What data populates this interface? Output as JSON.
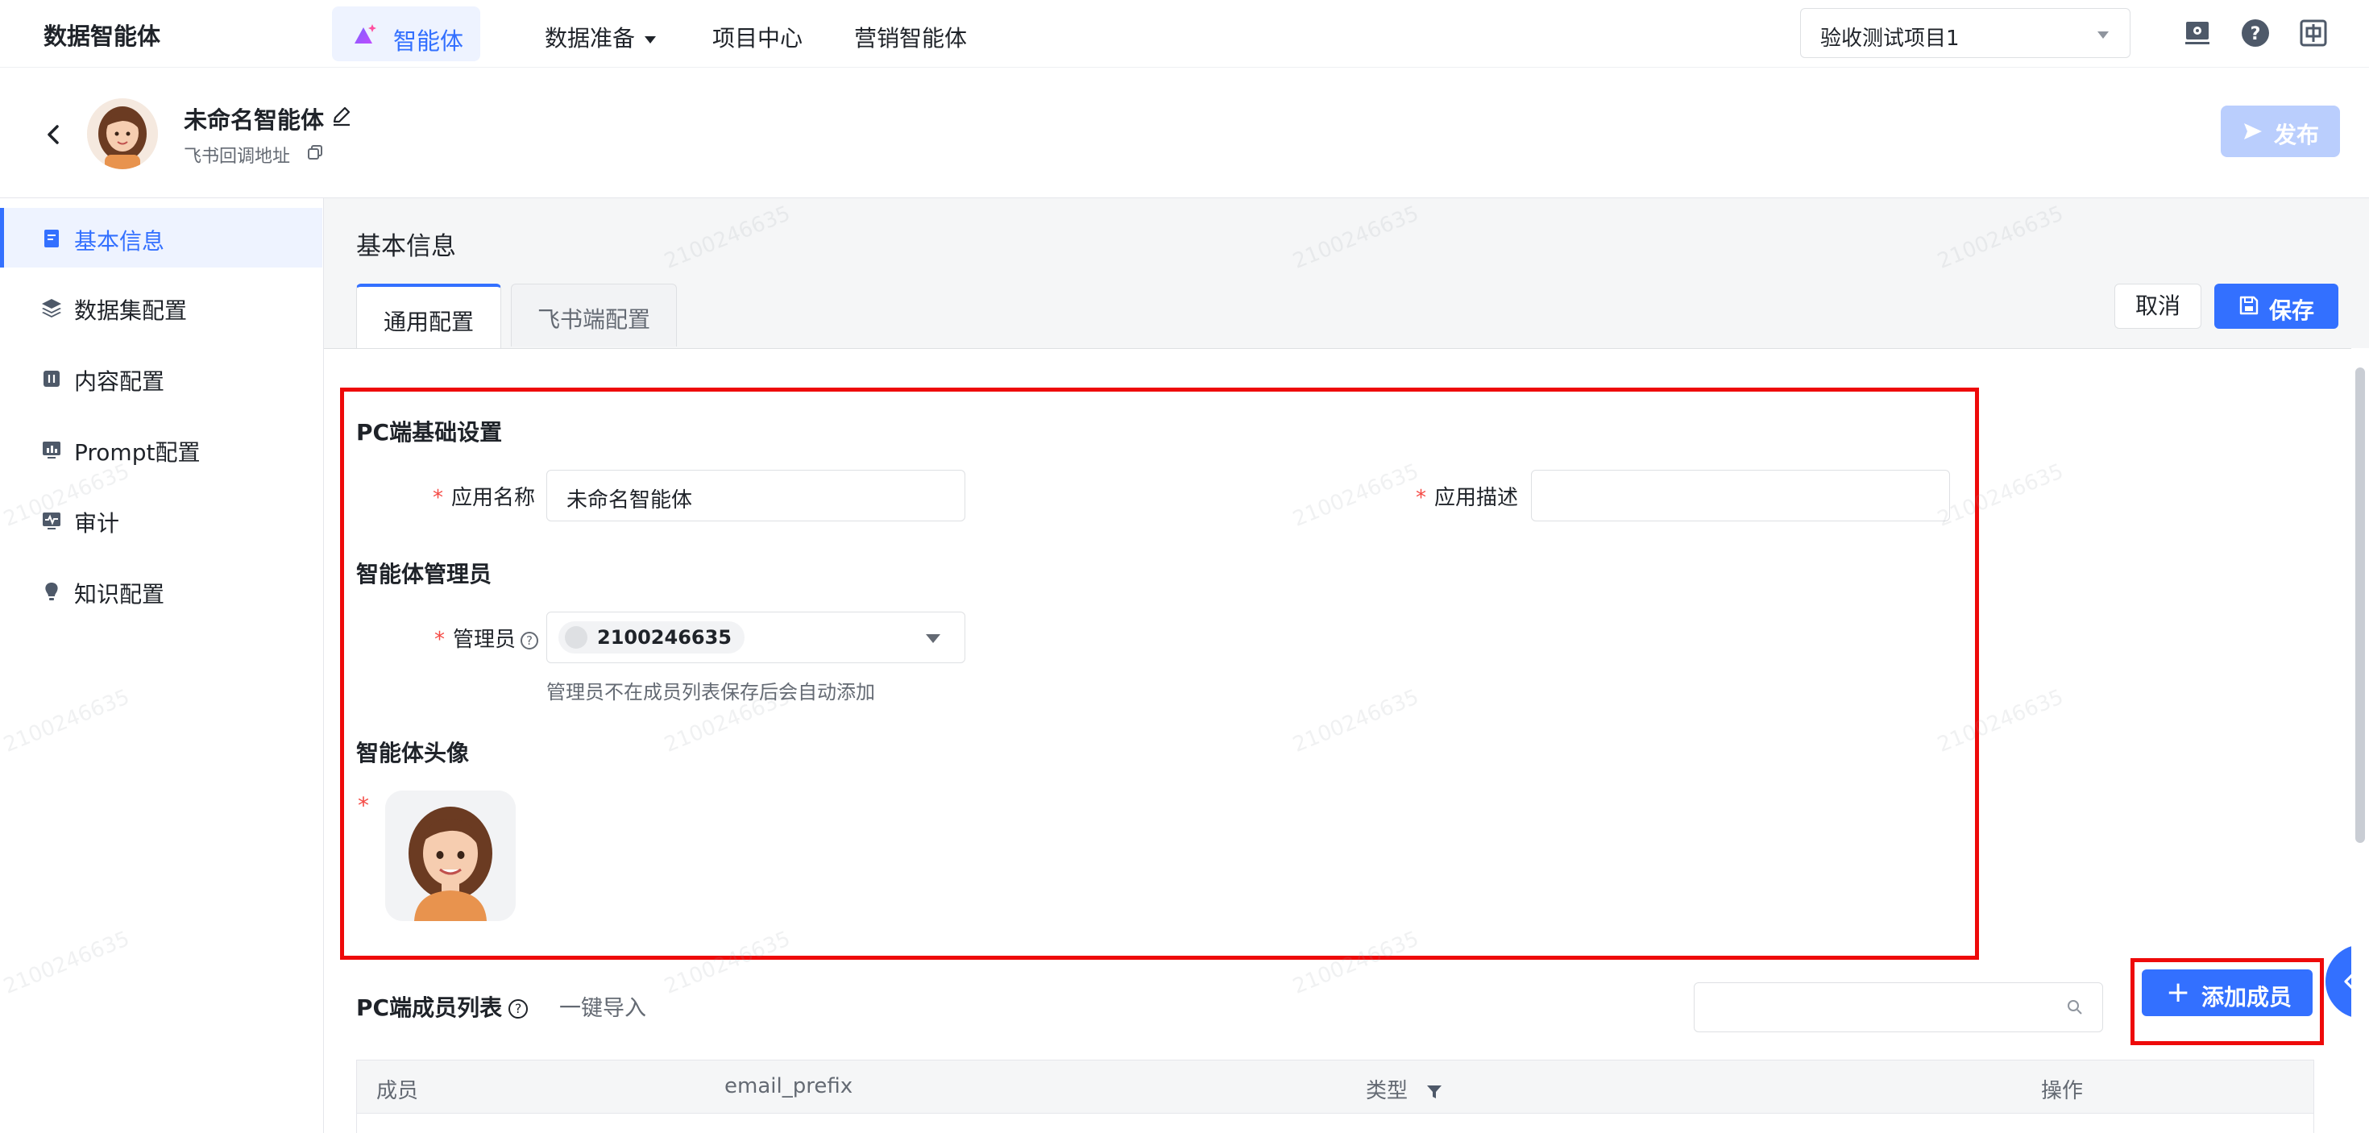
{
  "topbar": {
    "brand": "数据智能体",
    "nav": {
      "active": "智能体",
      "items": [
        "数据准备",
        "项目中心",
        "营销智能体"
      ]
    },
    "project_select": "验收测试项目1",
    "icons": [
      "monitor-settings-icon",
      "help-icon",
      "language-switch-icon"
    ]
  },
  "header": {
    "agent_name": "未命名智能体",
    "callback_label": "飞书回调地址",
    "publish_label": "发布"
  },
  "sidebar": {
    "items": [
      {
        "label": "基本信息",
        "icon": "document-icon",
        "active": true
      },
      {
        "label": "数据集配置",
        "icon": "layers-icon"
      },
      {
        "label": "内容配置",
        "icon": "content-icon"
      },
      {
        "label": "Prompt配置",
        "icon": "chart-icon"
      },
      {
        "label": "审计",
        "icon": "audit-icon"
      },
      {
        "label": "知识配置",
        "icon": "bulb-icon"
      }
    ]
  },
  "main": {
    "section_title": "基本信息",
    "tabs": [
      {
        "label": "通用配置",
        "active": true
      },
      {
        "label": "飞书端配置"
      }
    ],
    "cancel_label": "取消",
    "save_label": "保存",
    "pc_basic": {
      "title": "PC端基础设置",
      "app_name_label": "应用名称",
      "app_name_value": "未命名智能体",
      "app_desc_label": "应用描述",
      "app_desc_value": ""
    },
    "admin_section": {
      "title": "智能体管理员",
      "admin_label": "管理员",
      "admin_value": "2100246635",
      "help_text": "管理员不在成员列表保存后会自动添加"
    },
    "avatar_section": {
      "title": "智能体头像"
    },
    "members": {
      "title": "PC端成员列表",
      "import_label": "一键导入",
      "search_placeholder": "",
      "add_label": "添加成员",
      "columns": [
        "成员",
        "email_prefix",
        "类型",
        "操作"
      ]
    }
  },
  "watermark": "2100246635",
  "colors": {
    "accent": "#3370ff",
    "highlight": "#ee0a0a",
    "required": "#f54a45"
  }
}
